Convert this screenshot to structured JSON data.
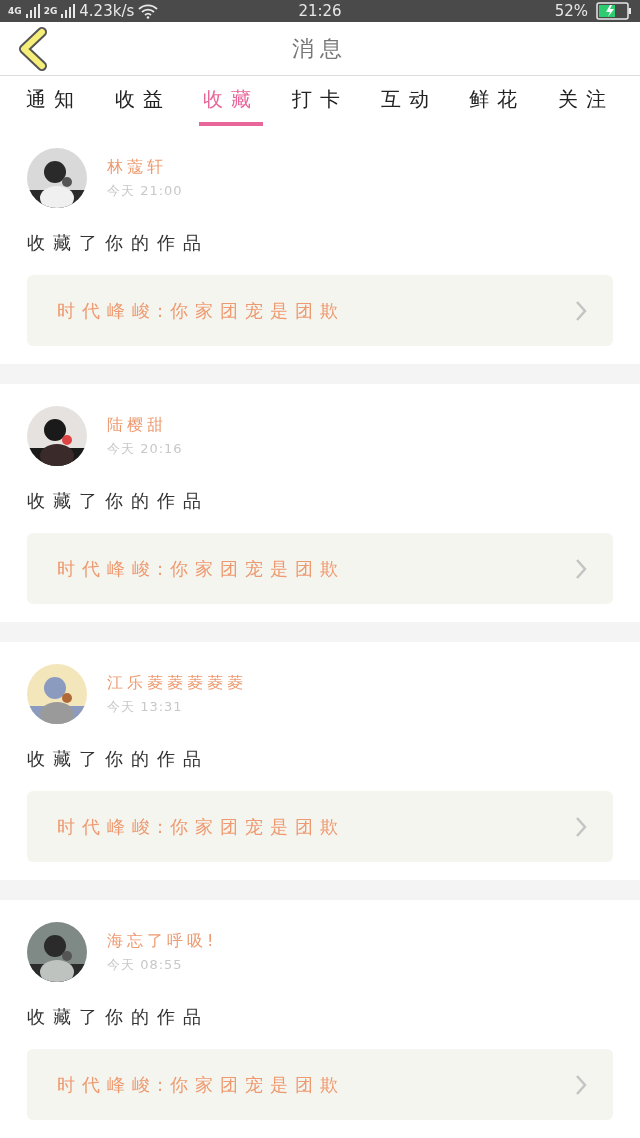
{
  "status_bar": {
    "network_1": "4G",
    "network_2": "2G",
    "speed": "4.23k/s",
    "time": "21:26",
    "battery": "52%"
  },
  "header": {
    "title": "消息"
  },
  "tabs": [
    {
      "label": "通知",
      "selected": false
    },
    {
      "label": "收益",
      "selected": false
    },
    {
      "label": "收藏",
      "selected": true
    },
    {
      "label": "打卡",
      "selected": false
    },
    {
      "label": "互动",
      "selected": false
    },
    {
      "label": "鲜花",
      "selected": false
    },
    {
      "label": "关注",
      "selected": false
    }
  ],
  "messages": [
    {
      "name": "林蔻轩",
      "time": "今天 21:00",
      "action": "收藏了你的作品",
      "work": "时代峰峻:你家团宠是团欺"
    },
    {
      "name": "陆樱甜",
      "time": "今天 20:16",
      "action": "收藏了你的作品",
      "work": "时代峰峻:你家团宠是团欺"
    },
    {
      "name": "江乐菱菱菱菱菱",
      "time": "今天 13:31",
      "action": "收藏了你的作品",
      "work": "时代峰峻:你家团宠是团欺"
    },
    {
      "name": "海忘了呼吸!",
      "time": "今天 08:55",
      "action": "收藏了你的作品",
      "work": "时代峰峻:你家团宠是团欺"
    }
  ]
}
